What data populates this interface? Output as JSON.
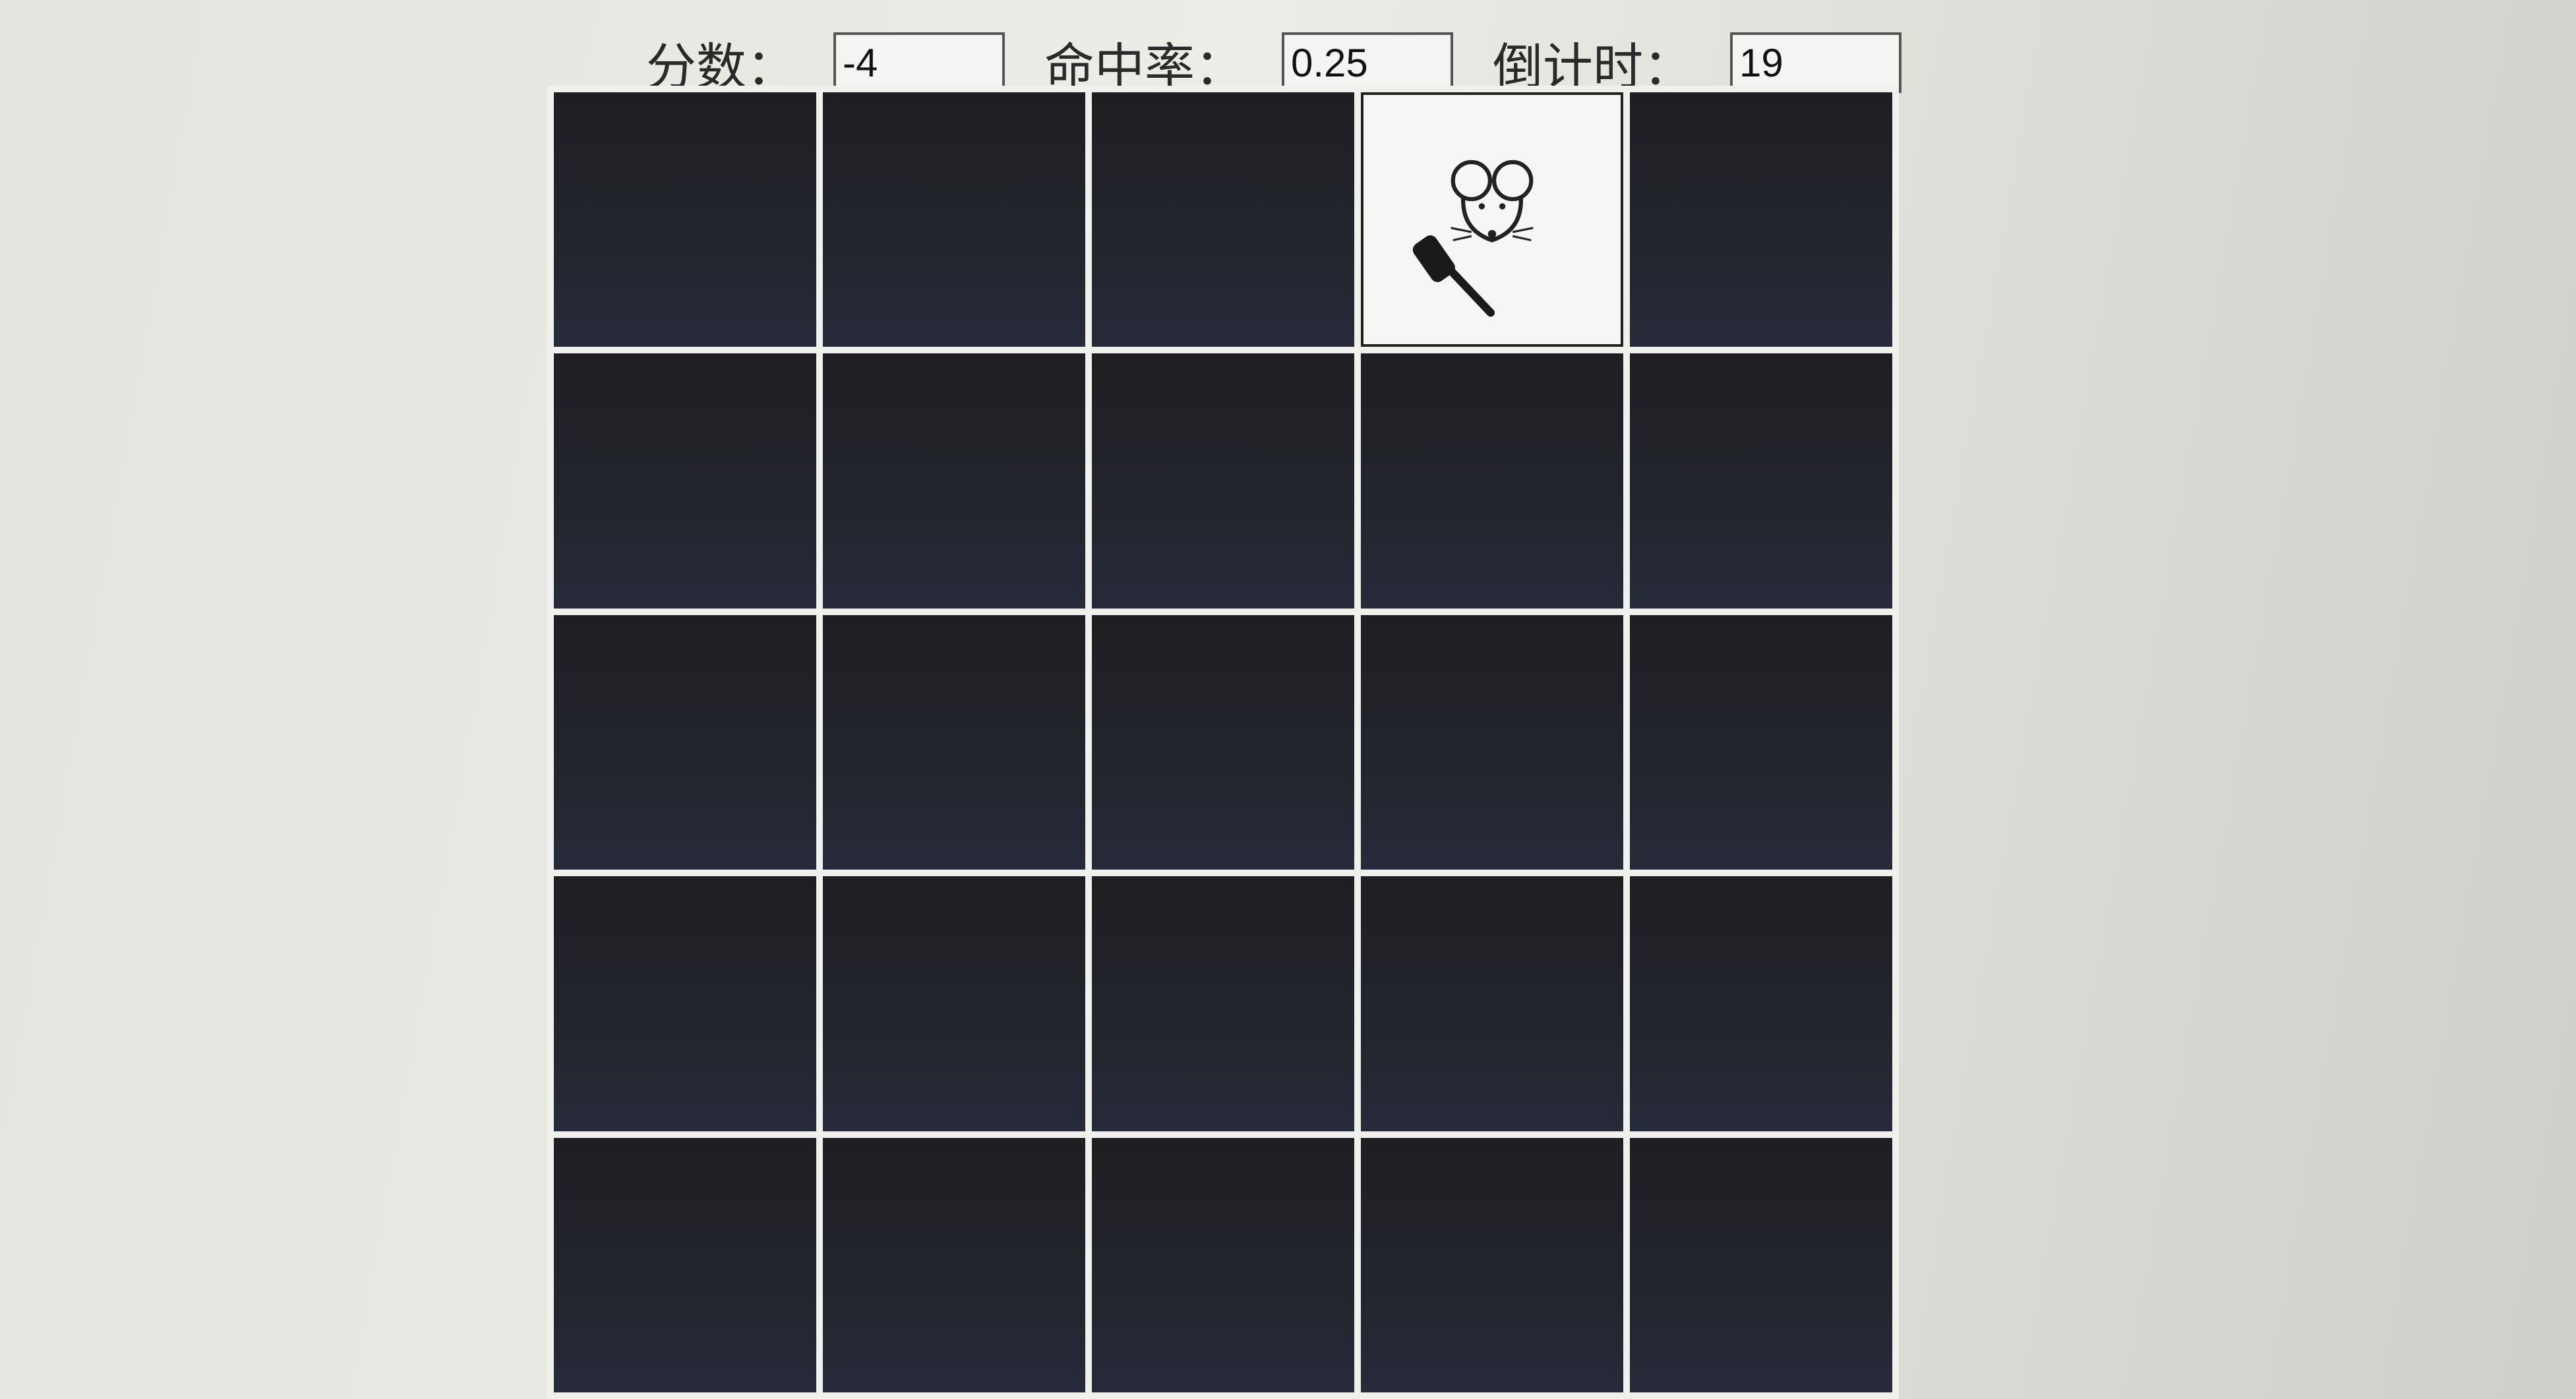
{
  "stats": {
    "score_label": "分数：",
    "score_value": "-4",
    "hit_rate_label": "命中率：",
    "hit_rate_value": "0.25",
    "countdown_label": "倒计时：",
    "countdown_value": "19"
  },
  "board": {
    "rows": 5,
    "columns": 5,
    "active_cell": {
      "row": 1,
      "column": 4
    },
    "active_icons": [
      "mouse-icon",
      "hammer-icon"
    ]
  },
  "colors": {
    "hole": "#1f2128",
    "grid_line": "#f0f0ec",
    "active_cell": "#f6f6f4"
  }
}
